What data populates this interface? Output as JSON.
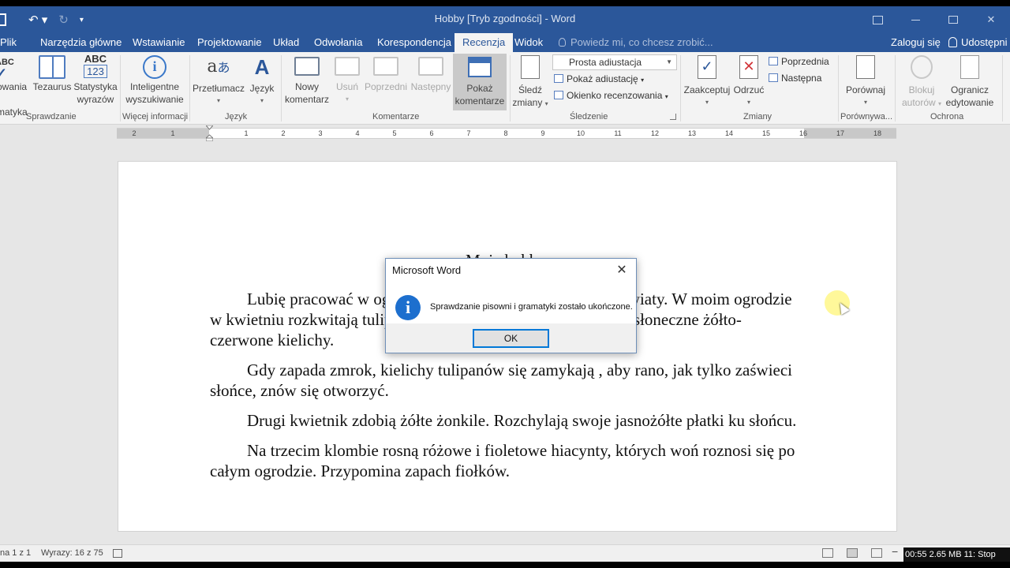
{
  "window": {
    "title": "Hobby [Tryb zgodności] - Word"
  },
  "tabs": [
    {
      "label": "Plik"
    },
    {
      "label": "Narzędzia główne"
    },
    {
      "label": "Wstawianie"
    },
    {
      "label": "Projektowanie"
    },
    {
      "label": "Układ"
    },
    {
      "label": "Odwołania"
    },
    {
      "label": "Korespondencja"
    },
    {
      "label": "Recenzja",
      "active": true
    },
    {
      "label": "Widok"
    }
  ],
  "tell_me": "Powiedz mi, co chcesz zrobić...",
  "sign_in": "Zaloguj się",
  "share": "Udostępni",
  "ribbon": {
    "proofing": {
      "spelling_line1": "owania i",
      "spelling_line2": "matyka",
      "thesaurus_icon": "ABC",
      "thesaurus": "Tezaurus",
      "wordcount_icon_top": "ABC",
      "wordcount_icon_bottom": "123",
      "wordcount_line1": "Statystyka",
      "wordcount_line2": "wyrazów",
      "label": "Sprawdzanie"
    },
    "insights": {
      "smart_lookup_line1": "Inteligentne",
      "smart_lookup_line2": "wyszukiwanie",
      "label": "Więcej informacji"
    },
    "language": {
      "translate": "Przetłumacz",
      "language": "Język",
      "label": "Język"
    },
    "comments": {
      "new_line1": "Nowy",
      "new_line2": "komentarz",
      "delete": "Usuń",
      "previous": "Poprzedni",
      "next": "Następny",
      "show_line1": "Pokaż",
      "show_line2": "komentarze",
      "label": "Komentarze"
    },
    "tracking": {
      "track_line1": "Śledź",
      "track_line2": "zmiany",
      "markup_select": "Prosta adiustacja",
      "show_markup": "Pokaż adiustację",
      "reviewing_pane": "Okienko recenzowania",
      "label": "Śledzenie"
    },
    "changes": {
      "accept": "Zaakceptuj",
      "reject": "Odrzuć",
      "previous": "Poprzednia",
      "next": "Następna",
      "label": "Zmiany"
    },
    "compare": {
      "compare": "Porównaj",
      "label": "Porównywa..."
    },
    "protect": {
      "block_line1": "Blokuj",
      "block_line2": "autorów",
      "restrict_line1": "Ogranicz",
      "restrict_line2": "edytowanie",
      "label": "Ochrona"
    }
  },
  "ruler": {
    "left_numbers": [
      "2",
      "1"
    ],
    "right_numbers": [
      "1",
      "2",
      "3",
      "4",
      "5",
      "6",
      "7",
      "8",
      "9",
      "10",
      "11",
      "12",
      "13",
      "14",
      "15",
      "16",
      "17",
      "18"
    ]
  },
  "document": {
    "title": "Moje hobby",
    "paragraphs": [
      "Lubię pracować w ogrodzie, najbardziej lubię uprawiać kwiaty. W moim ogrodzie w kwietniu rozkwitają tulipany. Jest to wczesna odmiana. Mają słoneczne żółto-czerwone kielichy.",
      "Gdy zapada zmrok, kielichy tulipanów się zamykają , aby rano, jak tylko zaświeci słońce, znów się otworzyć.",
      "Drugi kwietnik zdobią żółte żonkile. Rozchylają swoje jasnożółte płatki ku słońcu.",
      "Na trzecim klombie rosną różowe i fioletowe hiacynty, których woń roznosi się po całym ogrodzie. Przypomina zapach fiołków."
    ]
  },
  "dialog": {
    "title": "Microsoft Word",
    "icon": "info-icon",
    "message": "Sprawdzanie pisowni i gramatyki zostało ukończone.",
    "ok": "OK"
  },
  "status": {
    "page": "na 1 z 1",
    "words": "Wyrazy: 16 z 75"
  },
  "overlay": {
    "time": "00:55 2.65 MB 11: Stop"
  },
  "colors": {
    "titlebar": "#2b579a",
    "ribbon": "#f3f3f3",
    "dialog_icon": "#1d6fce"
  }
}
